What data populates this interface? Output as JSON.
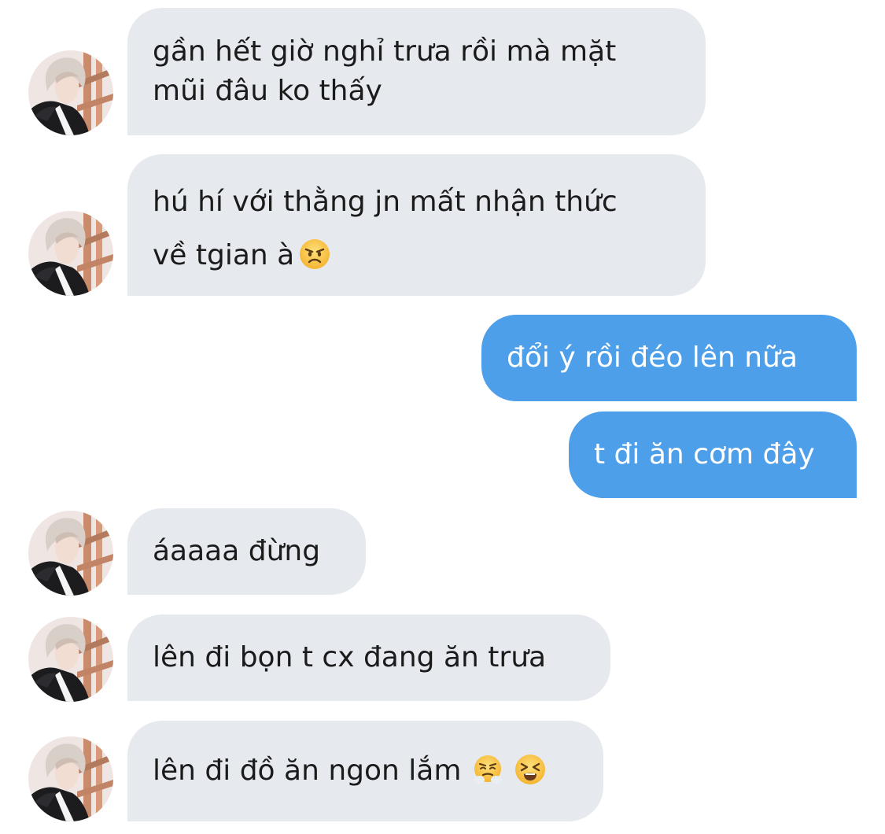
{
  "messages": [
    {
      "direction": "incoming",
      "lines": [
        "gần hết giờ nghỉ trưa rồi mà mặt",
        "mũi đâu ko thấy"
      ]
    },
    {
      "direction": "incoming",
      "lines": [
        "hú hí với thằng jn mất nhận thức",
        "về tgian à"
      ],
      "emojis": [
        "angry-face-emoji"
      ]
    },
    {
      "direction": "outgoing",
      "lines": [
        "đổi ý rồi đéo lên nữa"
      ]
    },
    {
      "direction": "outgoing",
      "lines": [
        "t đi ăn cơm đây"
      ]
    },
    {
      "direction": "incoming",
      "lines": [
        "áaaaa đừng"
      ]
    },
    {
      "direction": "incoming",
      "lines": [
        "lên đi bọn t cx đang ăn trưa"
      ]
    },
    {
      "direction": "incoming",
      "lines": [
        "lên đi đồ ăn ngon lắm"
      ],
      "emojis": [
        "steam-from-nose-emoji",
        "tired-face-emoji"
      ]
    }
  ],
  "colors": {
    "incoming_bubble": "#e6eaef",
    "outgoing_bubble": "#4e9fe9",
    "incoming_text": "#1b1b1b",
    "outgoing_text": "#ffffff"
  }
}
